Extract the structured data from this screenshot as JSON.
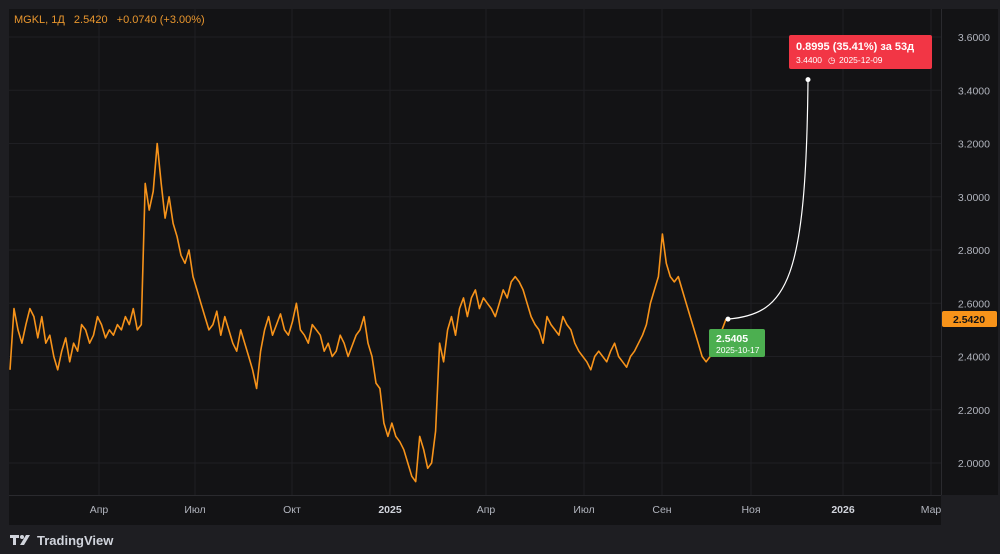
{
  "header": {
    "symbol": "MGKL, 1Д",
    "last": "2.5420",
    "change": "+0.0740 (+3.00%)"
  },
  "price_label": "2.5420",
  "forecast": {
    "target_line1": "0.8995 (35.41%) за 53д",
    "target_line2_price": "3.4400",
    "target_line2_date": "2025-12-09",
    "start_price": "2.5405",
    "start_date": "2025-10-17"
  },
  "footer": {
    "brand": "TradingView",
    "brand_icon": "tradingview-logo-icon"
  },
  "colors": {
    "line": "#f7931a",
    "target": "#f23645",
    "start": "#4caf50",
    "background": "#131315"
  },
  "chart_data": {
    "type": "line",
    "x_axis_labels": [
      "Апр",
      "Июл",
      "Окт",
      "2025",
      "Апр",
      "Июл",
      "Сен",
      "Ноя",
      "2026",
      "Мар"
    ],
    "bold_x_labels": [
      "2025",
      "2026"
    ],
    "y_ticks": [
      "3.6000",
      "3.4000",
      "3.2000",
      "3.0000",
      "2.8000",
      "2.6000",
      "2.4000",
      "2.2000",
      "2.0000"
    ],
    "ylim": [
      1.9,
      3.66
    ],
    "series": [
      {
        "values": [
          2.35,
          2.58,
          2.5,
          2.45,
          2.52,
          2.58,
          2.55,
          2.47,
          2.55,
          2.45,
          2.48,
          2.4,
          2.35,
          2.42,
          2.47,
          2.38,
          2.45,
          2.42,
          2.52,
          2.5,
          2.45,
          2.48,
          2.55,
          2.52,
          2.47,
          2.5,
          2.48,
          2.52,
          2.5,
          2.55,
          2.52,
          2.58,
          2.5,
          2.52,
          3.05,
          2.95,
          3.02,
          3.2,
          3.05,
          2.92,
          3.0,
          2.9,
          2.85,
          2.78,
          2.75,
          2.8,
          2.7,
          2.65,
          2.6,
          2.55,
          2.5,
          2.52,
          2.57,
          2.48,
          2.55,
          2.5,
          2.45,
          2.42,
          2.5,
          2.45,
          2.4,
          2.35,
          2.28,
          2.42,
          2.5,
          2.55,
          2.48,
          2.52,
          2.56,
          2.5,
          2.48,
          2.53,
          2.6,
          2.5,
          2.48,
          2.45,
          2.52,
          2.5,
          2.48,
          2.42,
          2.45,
          2.4,
          2.42,
          2.48,
          2.45,
          2.4,
          2.44,
          2.48,
          2.5,
          2.55,
          2.45,
          2.4,
          2.3,
          2.28,
          2.15,
          2.1,
          2.15,
          2.1,
          2.08,
          2.05,
          2.0,
          1.95,
          1.93,
          2.1,
          2.05,
          1.98,
          2.0,
          2.12,
          2.45,
          2.38,
          2.5,
          2.55,
          2.48,
          2.58,
          2.62,
          2.55,
          2.62,
          2.65,
          2.58,
          2.62,
          2.6,
          2.58,
          2.55,
          2.6,
          2.65,
          2.62,
          2.68,
          2.7,
          2.68,
          2.65,
          2.6,
          2.55,
          2.52,
          2.5,
          2.45,
          2.55,
          2.52,
          2.5,
          2.48,
          2.55,
          2.52,
          2.5,
          2.45,
          2.42,
          2.4,
          2.38,
          2.35,
          2.4,
          2.42,
          2.4,
          2.38,
          2.42,
          2.45,
          2.4,
          2.38,
          2.36,
          2.4,
          2.42,
          2.45,
          2.48,
          2.52,
          2.6,
          2.65,
          2.7,
          2.86,
          2.75,
          2.7,
          2.68,
          2.7,
          2.65,
          2.6,
          2.55,
          2.5,
          2.45,
          2.4,
          2.38,
          2.4,
          2.42,
          2.45,
          2.5,
          2.54
        ]
      }
    ],
    "forecast_points": [
      {
        "price": 2.5405,
        "date": "2025-10-17"
      },
      {
        "price": 3.44,
        "date": "2025-12-09"
      }
    ]
  }
}
